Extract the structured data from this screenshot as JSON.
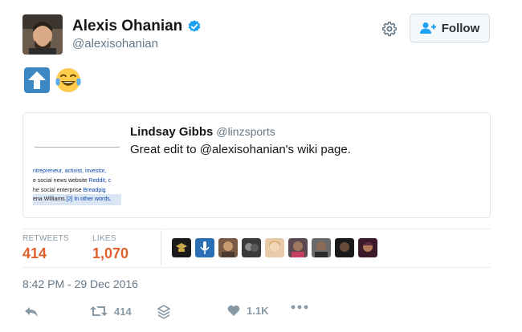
{
  "author": {
    "name": "Alexis Ohanian",
    "handle": "@alexisohanian",
    "verified": true
  },
  "header": {
    "follow_label": "Follow"
  },
  "body": {
    "emojis": [
      "up-arrow-emoji",
      "tears-of-joy-emoji"
    ]
  },
  "quoted_tweet": {
    "name": "Lindsay Gibbs",
    "handle": "@linzsports",
    "text": "Great edit to @alexisohanian's wiki page.",
    "thumbnail_lines": [
      "ntrepreneur, activist, investor, ",
      "e social news website ",
      "he social enterprise ",
      "ena Williams."
    ],
    "thumbnail_links": [
      "Reddit, c",
      "Breadpig",
      "[2] In other words,"
    ]
  },
  "stats": {
    "retweets_label": "RETWEETS",
    "retweets_value": "414",
    "likes_label": "LIKES",
    "likes_value": "1,070",
    "liker_avatar_count": 10
  },
  "timestamp": "8:42 PM - 29 Dec 2016",
  "actions": {
    "retweet_count": "414",
    "like_count": "1.1K"
  },
  "colors": {
    "accent_blue": "#1da1f2",
    "stat_orange": "#e0612b",
    "muted_gray": "#657786"
  }
}
